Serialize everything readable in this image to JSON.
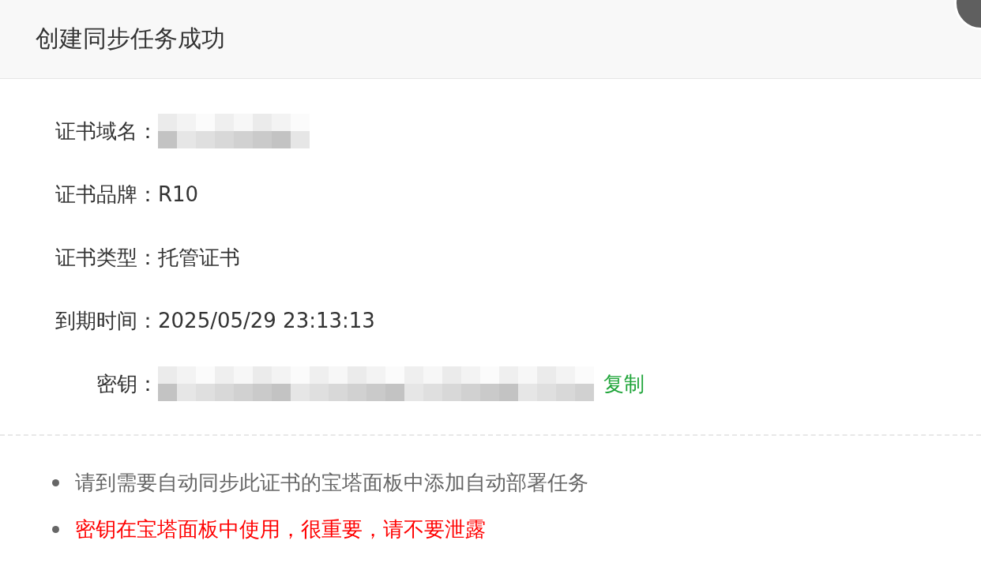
{
  "dialog": {
    "title": "创建同步任务成功"
  },
  "fields": [
    {
      "label": "证书域名：",
      "kind": "redacted"
    },
    {
      "label": "证书品牌：",
      "kind": "text",
      "value": "R10"
    },
    {
      "label": "证书类型：",
      "kind": "text",
      "value": "托管证书"
    },
    {
      "label": "到期时间：",
      "kind": "text",
      "value": "2025/05/29 23:13:13"
    },
    {
      "label": "密钥：",
      "kind": "redacted_long",
      "action": "复制"
    }
  ],
  "notes": [
    {
      "text": "请到需要自动同步此证书的宝塔面板中添加自动部署任务",
      "color": "#666666"
    },
    {
      "text": "密钥在宝塔面板中使用，很重要，请不要泄露",
      "color": "#ff0000"
    }
  ]
}
